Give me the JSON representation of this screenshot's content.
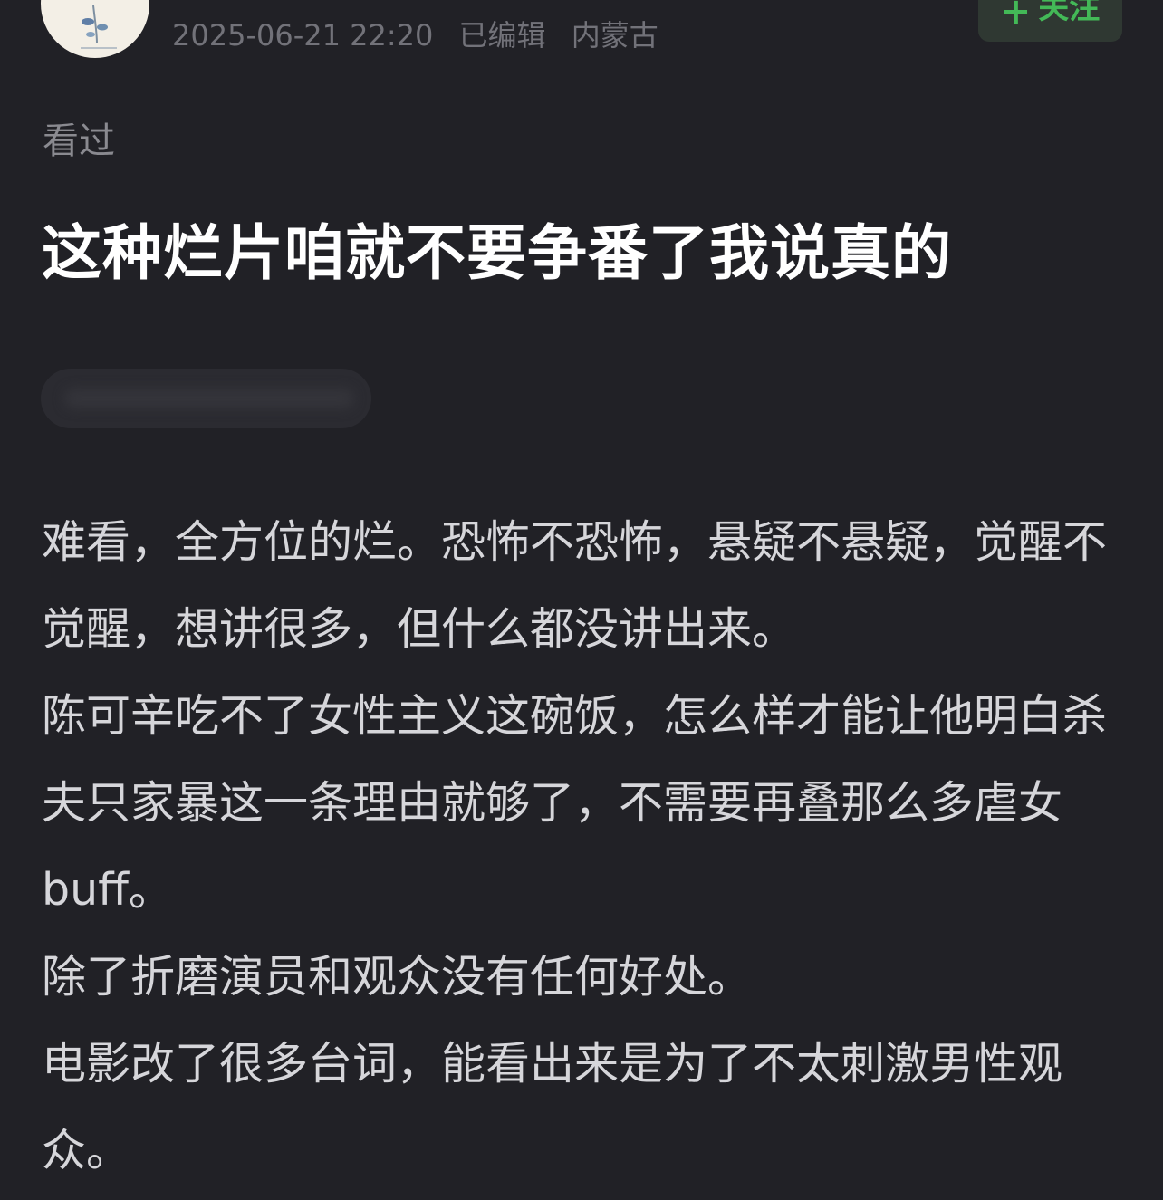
{
  "author": {
    "meta_date": "2025-06-21 22:20",
    "meta_edited": "已编辑",
    "meta_location": "内蒙古"
  },
  "follow_button": {
    "icon": "plus-icon",
    "label": "关注",
    "color": "#43b957"
  },
  "status": "看过",
  "title": "这种烂片咱就不要争番了我说真的",
  "review": {
    "paragraphs": [
      "难看，全方位的烂。恐怖不恐怖，悬疑不悬疑，觉醒不觉醒，想讲很多，但什么都没讲出来。",
      "陈可辛吃不了女性主义这碗饭，怎么样才能让他明白杀夫只家暴这一条理由就够了，不需要再叠那么多虐女buff。",
      "除了折磨演员和观众没有任何好处。",
      "电影改了很多台词，能看出来是为了不太刺激男性观众。"
    ]
  },
  "colors": {
    "background": "#212126",
    "title": "#ffffff",
    "body_text": "#d6d6da",
    "meta_text": "#727279"
  }
}
